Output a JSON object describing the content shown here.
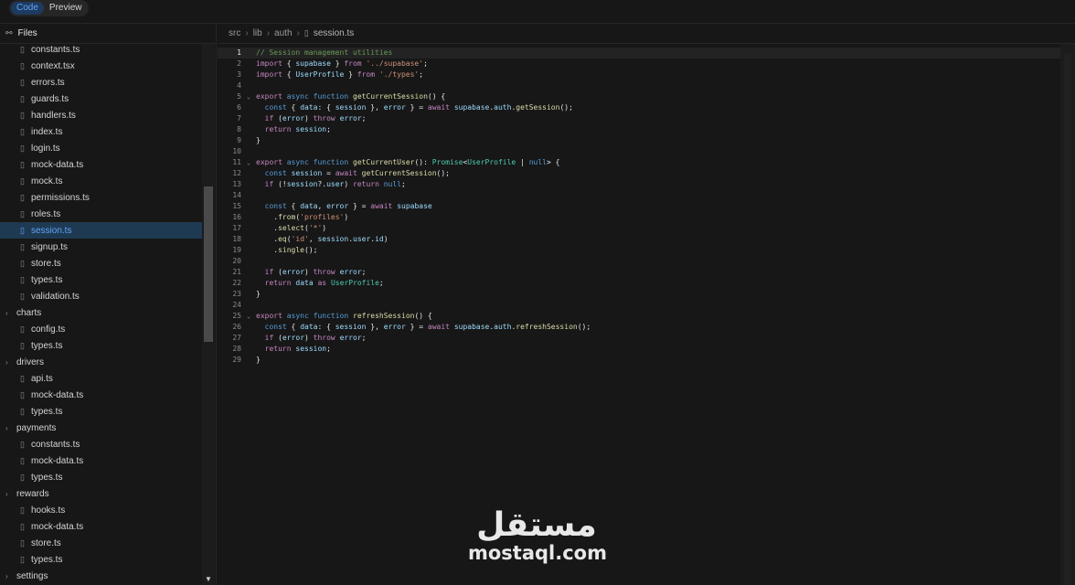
{
  "tabs": {
    "code": "Code",
    "preview": "Preview"
  },
  "sidebar": {
    "title": "Files",
    "tree": [
      {
        "kind": "file",
        "label": "constants.ts"
      },
      {
        "kind": "file",
        "label": "context.tsx"
      },
      {
        "kind": "file",
        "label": "errors.ts"
      },
      {
        "kind": "file",
        "label": "guards.ts"
      },
      {
        "kind": "file",
        "label": "handlers.ts"
      },
      {
        "kind": "file",
        "label": "index.ts"
      },
      {
        "kind": "file",
        "label": "login.ts"
      },
      {
        "kind": "file",
        "label": "mock-data.ts"
      },
      {
        "kind": "file",
        "label": "mock.ts"
      },
      {
        "kind": "file",
        "label": "permissions.ts"
      },
      {
        "kind": "file",
        "label": "roles.ts"
      },
      {
        "kind": "file",
        "label": "session.ts",
        "selected": true
      },
      {
        "kind": "file",
        "label": "signup.ts"
      },
      {
        "kind": "file",
        "label": "store.ts"
      },
      {
        "kind": "file",
        "label": "types.ts"
      },
      {
        "kind": "file",
        "label": "validation.ts"
      },
      {
        "kind": "folder",
        "label": "charts"
      },
      {
        "kind": "file",
        "label": "config.ts"
      },
      {
        "kind": "file",
        "label": "types.ts"
      },
      {
        "kind": "folder",
        "label": "drivers"
      },
      {
        "kind": "file",
        "label": "api.ts"
      },
      {
        "kind": "file",
        "label": "mock-data.ts"
      },
      {
        "kind": "file",
        "label": "types.ts"
      },
      {
        "kind": "folder",
        "label": "payments"
      },
      {
        "kind": "file",
        "label": "constants.ts"
      },
      {
        "kind": "file",
        "label": "mock-data.ts"
      },
      {
        "kind": "file",
        "label": "types.ts"
      },
      {
        "kind": "folder",
        "label": "rewards"
      },
      {
        "kind": "file",
        "label": "hooks.ts"
      },
      {
        "kind": "file",
        "label": "mock-data.ts"
      },
      {
        "kind": "file",
        "label": "store.ts"
      },
      {
        "kind": "file",
        "label": "types.ts"
      },
      {
        "kind": "folder",
        "label": "settings"
      }
    ]
  },
  "breadcrumb": [
    "src",
    "lib",
    "auth",
    "session.ts"
  ],
  "code": {
    "current_line": 1,
    "lines": [
      [
        [
          "c",
          "// Session management utilities"
        ]
      ],
      [
        [
          "k",
          "import"
        ],
        [
          "txt",
          " { "
        ],
        [
          "v",
          "supabase"
        ],
        [
          "txt",
          " } "
        ],
        [
          "k",
          "from"
        ],
        [
          "txt",
          " "
        ],
        [
          "s",
          "'../supabase'"
        ],
        [
          "txt",
          ";"
        ]
      ],
      [
        [
          "k",
          "import"
        ],
        [
          "txt",
          " { "
        ],
        [
          "v",
          "UserProfile"
        ],
        [
          "txt",
          " } "
        ],
        [
          "k",
          "from"
        ],
        [
          "txt",
          " "
        ],
        [
          "s",
          "'./types'"
        ],
        [
          "txt",
          ";"
        ]
      ],
      [],
      [
        [
          "k",
          "export"
        ],
        [
          "txt",
          " "
        ],
        [
          "kb",
          "async"
        ],
        [
          "txt",
          " "
        ],
        [
          "kb",
          "function"
        ],
        [
          "txt",
          " "
        ],
        [
          "f",
          "getCurrentSession"
        ],
        [
          "txt",
          "() {"
        ]
      ],
      [
        [
          "txt",
          "  "
        ],
        [
          "kb",
          "const"
        ],
        [
          "txt",
          " { "
        ],
        [
          "v",
          "data"
        ],
        [
          "txt",
          ": { "
        ],
        [
          "v",
          "session"
        ],
        [
          "txt",
          " }, "
        ],
        [
          "v",
          "error"
        ],
        [
          "txt",
          " } = "
        ],
        [
          "k",
          "await"
        ],
        [
          "txt",
          " "
        ],
        [
          "v",
          "supabase"
        ],
        [
          "txt",
          "."
        ],
        [
          "v",
          "auth"
        ],
        [
          "txt",
          "."
        ],
        [
          "f",
          "getSession"
        ],
        [
          "txt",
          "();"
        ]
      ],
      [
        [
          "txt",
          "  "
        ],
        [
          "k",
          "if"
        ],
        [
          "txt",
          " ("
        ],
        [
          "v",
          "error"
        ],
        [
          "txt",
          ") "
        ],
        [
          "k",
          "throw"
        ],
        [
          "txt",
          " "
        ],
        [
          "v",
          "error"
        ],
        [
          "txt",
          ";"
        ]
      ],
      [
        [
          "txt",
          "  "
        ],
        [
          "k",
          "return"
        ],
        [
          "txt",
          " "
        ],
        [
          "v",
          "session"
        ],
        [
          "txt",
          ";"
        ]
      ],
      [
        [
          "txt",
          "}"
        ]
      ],
      [],
      [
        [
          "k",
          "export"
        ],
        [
          "txt",
          " "
        ],
        [
          "kb",
          "async"
        ],
        [
          "txt",
          " "
        ],
        [
          "kb",
          "function"
        ],
        [
          "txt",
          " "
        ],
        [
          "f",
          "getCurrentUser"
        ],
        [
          "txt",
          "(): "
        ],
        [
          "t",
          "Promise"
        ],
        [
          "txt",
          "<"
        ],
        [
          "t",
          "UserProfile"
        ],
        [
          "txt",
          " | "
        ],
        [
          "kb",
          "null"
        ],
        [
          "txt",
          "> {"
        ]
      ],
      [
        [
          "txt",
          "  "
        ],
        [
          "kb",
          "const"
        ],
        [
          "txt",
          " "
        ],
        [
          "v",
          "session"
        ],
        [
          "txt",
          " = "
        ],
        [
          "k",
          "await"
        ],
        [
          "txt",
          " "
        ],
        [
          "f",
          "getCurrentSession"
        ],
        [
          "txt",
          "();"
        ]
      ],
      [
        [
          "txt",
          "  "
        ],
        [
          "k",
          "if"
        ],
        [
          "txt",
          " (!"
        ],
        [
          "v",
          "session"
        ],
        [
          "txt",
          "?."
        ],
        [
          "v",
          "user"
        ],
        [
          "txt",
          ") "
        ],
        [
          "k",
          "return"
        ],
        [
          "txt",
          " "
        ],
        [
          "kb",
          "null"
        ],
        [
          "txt",
          ";"
        ]
      ],
      [],
      [
        [
          "txt",
          "  "
        ],
        [
          "kb",
          "const"
        ],
        [
          "txt",
          " { "
        ],
        [
          "v",
          "data"
        ],
        [
          "txt",
          ", "
        ],
        [
          "v",
          "error"
        ],
        [
          "txt",
          " } = "
        ],
        [
          "k",
          "await"
        ],
        [
          "txt",
          " "
        ],
        [
          "v",
          "supabase"
        ]
      ],
      [
        [
          "txt",
          "    ."
        ],
        [
          "f",
          "from"
        ],
        [
          "txt",
          "("
        ],
        [
          "s",
          "'profiles'"
        ],
        [
          "txt",
          ")"
        ]
      ],
      [
        [
          "txt",
          "    ."
        ],
        [
          "f",
          "select"
        ],
        [
          "txt",
          "("
        ],
        [
          "s",
          "'*'"
        ],
        [
          "txt",
          ")"
        ]
      ],
      [
        [
          "txt",
          "    ."
        ],
        [
          "f",
          "eq"
        ],
        [
          "txt",
          "("
        ],
        [
          "s",
          "'id'"
        ],
        [
          "txt",
          ", "
        ],
        [
          "v",
          "session"
        ],
        [
          "txt",
          "."
        ],
        [
          "v",
          "user"
        ],
        [
          "txt",
          "."
        ],
        [
          "v",
          "id"
        ],
        [
          "txt",
          ")"
        ]
      ],
      [
        [
          "txt",
          "    ."
        ],
        [
          "f",
          "single"
        ],
        [
          "txt",
          "();"
        ]
      ],
      [],
      [
        [
          "txt",
          "  "
        ],
        [
          "k",
          "if"
        ],
        [
          "txt",
          " ("
        ],
        [
          "v",
          "error"
        ],
        [
          "txt",
          ") "
        ],
        [
          "k",
          "throw"
        ],
        [
          "txt",
          " "
        ],
        [
          "v",
          "error"
        ],
        [
          "txt",
          ";"
        ]
      ],
      [
        [
          "txt",
          "  "
        ],
        [
          "k",
          "return"
        ],
        [
          "txt",
          " "
        ],
        [
          "v",
          "data"
        ],
        [
          "txt",
          " "
        ],
        [
          "k",
          "as"
        ],
        [
          "txt",
          " "
        ],
        [
          "t",
          "UserProfile"
        ],
        [
          "txt",
          ";"
        ]
      ],
      [
        [
          "txt",
          "}"
        ]
      ],
      [],
      [
        [
          "k",
          "export"
        ],
        [
          "txt",
          " "
        ],
        [
          "kb",
          "async"
        ],
        [
          "txt",
          " "
        ],
        [
          "kb",
          "function"
        ],
        [
          "txt",
          " "
        ],
        [
          "f",
          "refreshSession"
        ],
        [
          "txt",
          "() {"
        ]
      ],
      [
        [
          "txt",
          "  "
        ],
        [
          "kb",
          "const"
        ],
        [
          "txt",
          " { "
        ],
        [
          "v",
          "data"
        ],
        [
          "txt",
          ": { "
        ],
        [
          "v",
          "session"
        ],
        [
          "txt",
          " }, "
        ],
        [
          "v",
          "error"
        ],
        [
          "txt",
          " } = "
        ],
        [
          "k",
          "await"
        ],
        [
          "txt",
          " "
        ],
        [
          "v",
          "supabase"
        ],
        [
          "txt",
          "."
        ],
        [
          "v",
          "auth"
        ],
        [
          "txt",
          "."
        ],
        [
          "f",
          "refreshSession"
        ],
        [
          "txt",
          "();"
        ]
      ],
      [
        [
          "txt",
          "  "
        ],
        [
          "k",
          "if"
        ],
        [
          "txt",
          " ("
        ],
        [
          "v",
          "error"
        ],
        [
          "txt",
          ") "
        ],
        [
          "k",
          "throw"
        ],
        [
          "txt",
          " "
        ],
        [
          "v",
          "error"
        ],
        [
          "txt",
          ";"
        ]
      ],
      [
        [
          "txt",
          "  "
        ],
        [
          "k",
          "return"
        ],
        [
          "txt",
          " "
        ],
        [
          "v",
          "session"
        ],
        [
          "txt",
          ";"
        ]
      ],
      [
        [
          "txt",
          "}"
        ]
      ]
    ],
    "fold_lines": [
      5,
      11,
      25
    ]
  },
  "watermark": {
    "arabic": "مستقل",
    "latin": "mostaql.com"
  }
}
